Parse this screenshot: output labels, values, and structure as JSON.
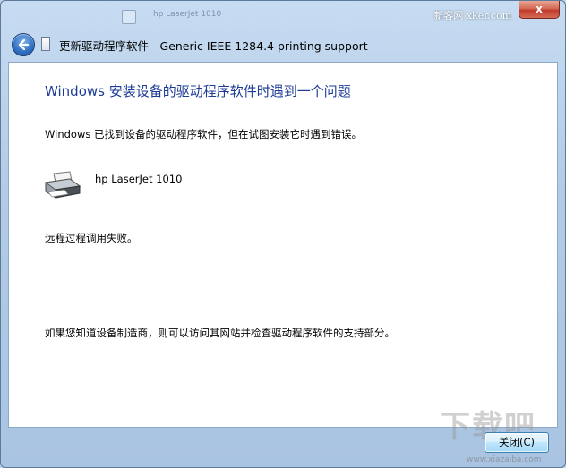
{
  "background_window": {
    "title": "hp LaserJet 1010"
  },
  "watermark_text": "新客网 xker.com",
  "titlebar": {
    "close_glyph": "x"
  },
  "window_title": "更新驱动程序软件 - Generic IEEE 1284.4 printing support",
  "content": {
    "heading": "Windows 安装设备的驱动程序软件时遇到一个问题",
    "message": "Windows 已找到设备的驱动程序软件，但在试图安装它时遇到错误。",
    "device_name": "hp LaserJet 1010",
    "error_text": "远程过程调用失败。",
    "footer_text": "如果您知道设备制造商，则可以访问其网站并检查驱动程序软件的支持部分。"
  },
  "buttons": {
    "close_label": "关闭(C)"
  },
  "watermark_logo": {
    "text": "下载吧",
    "url": "www.xiazaiba.com"
  },
  "icons": {
    "back": "back-arrow-icon",
    "printer": "printer-icon",
    "title": "driver-window-icon"
  },
  "colors": {
    "heading": "#1e3c96",
    "close_button": "#c0392b",
    "frame": "#b3cbe6"
  }
}
